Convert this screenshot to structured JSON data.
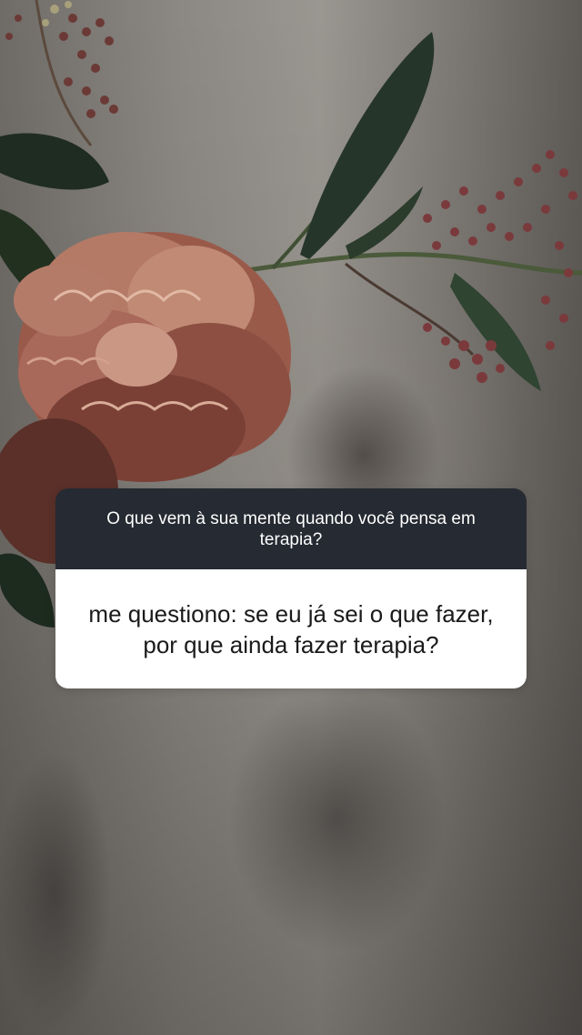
{
  "story": {
    "background_image": "flower-and-mug-photo",
    "question_sticker": {
      "question": "O que vem à sua mente quando você pensa em terapia?",
      "answer": "me questiono: se eu já sei o que fazer, por que ainda fazer terapia?",
      "header_color": "#262a32",
      "body_color": "#ffffff"
    }
  }
}
